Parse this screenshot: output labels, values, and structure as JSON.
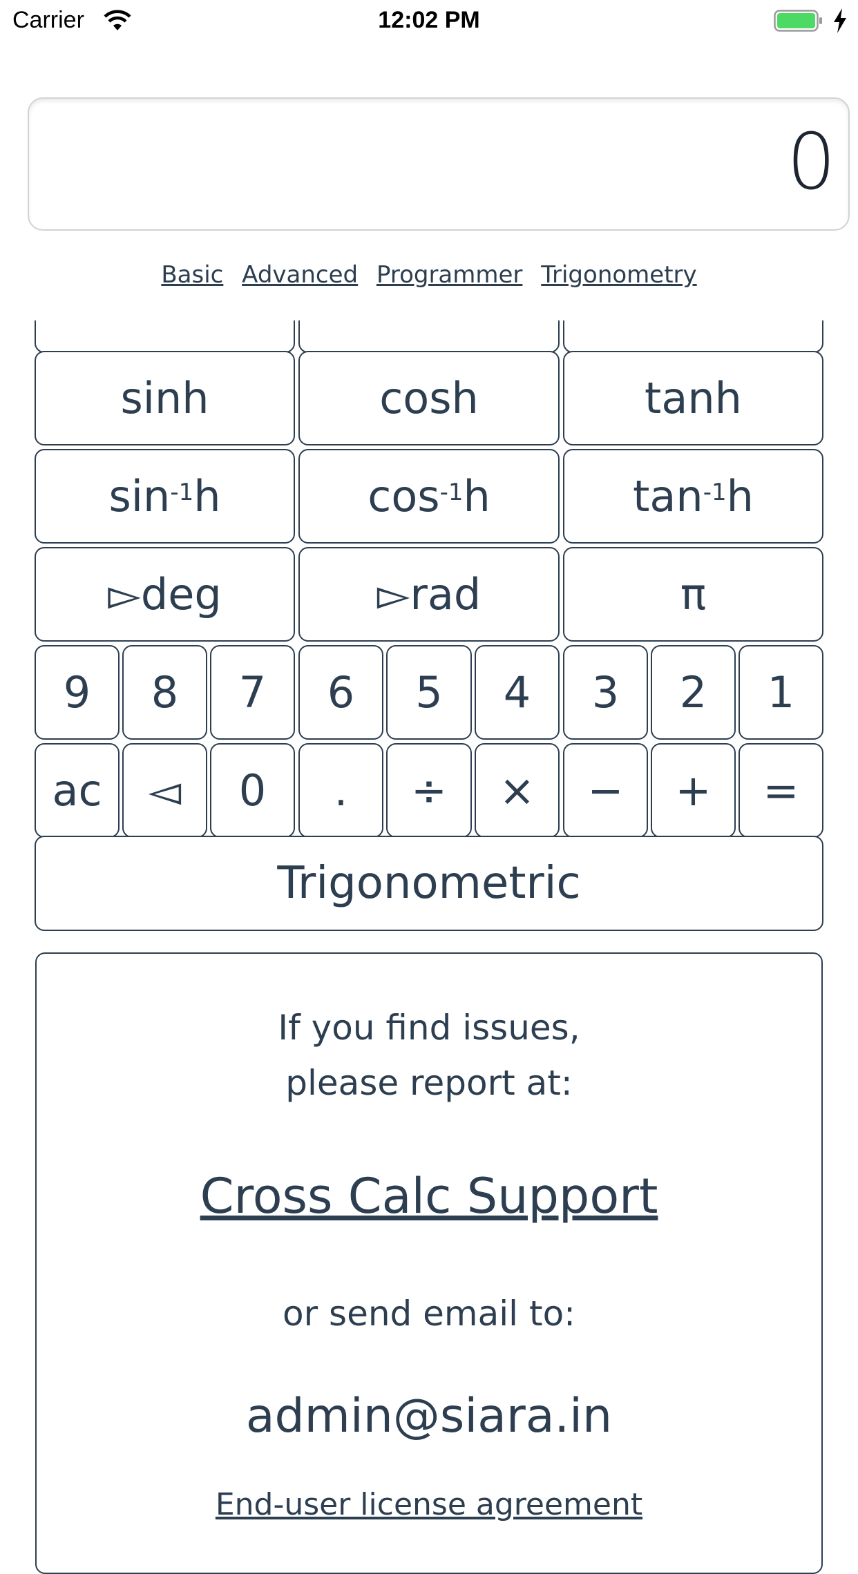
{
  "status_bar": {
    "carrier": "Carrier",
    "time": "12:02 PM"
  },
  "display": {
    "value": "0"
  },
  "modes": [
    "Basic",
    "Advanced",
    "Programmer",
    "Trigonometry"
  ],
  "keys": {
    "hyperbolic": [
      "sinh",
      "cosh",
      "tanh"
    ],
    "inverse_hyperbolic": [
      {
        "base": "sin",
        "sup": "-1",
        "suffix": "h"
      },
      {
        "base": "cos",
        "sup": "-1",
        "suffix": "h"
      },
      {
        "base": "tan",
        "sup": "-1",
        "suffix": "h"
      }
    ],
    "conversion": [
      "▻deg",
      "▻rad",
      "π"
    ],
    "digits": [
      "9",
      "8",
      "7",
      "6",
      "5",
      "4",
      "3",
      "2",
      "1"
    ],
    "operators": [
      "ac",
      "◅",
      "0",
      ".",
      "÷",
      "×",
      "−",
      "+",
      "="
    ],
    "mode_toggle": "Trigonometric"
  },
  "info": {
    "line1": "If you find issues,",
    "line2": "please report at:",
    "support_link": "Cross Calc Support",
    "line3": "or send email to:",
    "email": "admin@siara.in",
    "eula_link": "End-user license agreement"
  }
}
